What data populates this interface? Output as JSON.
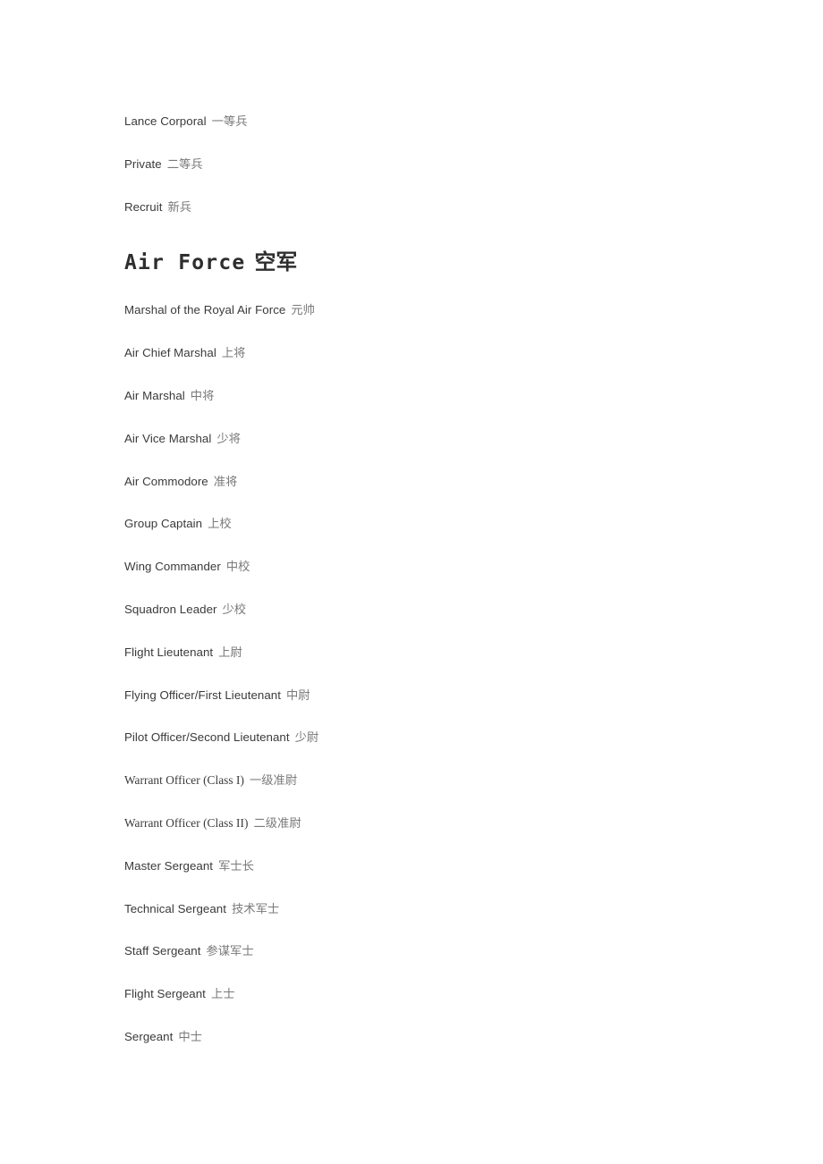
{
  "document": {
    "type": "bilingual-rank-list",
    "page_background": "#ffffff",
    "english_text_color": "#3a3a3a",
    "chinese_text_color": "#7a7a7a",
    "heading_color": "#2e2e2e"
  },
  "continued_entries": [
    {
      "en": "Lance Corporal",
      "zh": "一等兵"
    },
    {
      "en": "Private",
      "zh": "二等兵"
    },
    {
      "en": "Recruit",
      "zh": "新兵"
    }
  ],
  "section": {
    "heading_en": "Air Force",
    "heading_zh": "空军"
  },
  "air_force_ranks": [
    {
      "en": "Marshal of the Royal Air Force",
      "zh": "元帅"
    },
    {
      "en": "Air Chief Marshal",
      "zh": "上将"
    },
    {
      "en": "Air Marshal",
      "zh": "中将"
    },
    {
      "en": "Air Vice Marshal",
      "zh": "少将"
    },
    {
      "en": "Air Commodore",
      "zh": "准将"
    },
    {
      "en": "Group Captain",
      "zh": "上校"
    },
    {
      "en": "Wing Commander",
      "zh": "中校"
    },
    {
      "en": "Squadron Leader",
      "zh": "少校"
    },
    {
      "en": "Flight Lieutenant",
      "zh": "上尉"
    },
    {
      "en": "Flying Officer/First Lieutenant",
      "zh": "中尉"
    },
    {
      "en": "Pilot Officer/Second Lieutenant",
      "zh": "少尉"
    },
    {
      "en": "Warrant Officer (Class I)",
      "zh": "一级准尉"
    },
    {
      "en": "Warrant Officer (Class II)",
      "zh": "二级准尉"
    },
    {
      "en": "Master Sergeant",
      "zh": "军士长"
    },
    {
      "en": "Technical Sergeant",
      "zh": "技术军士"
    },
    {
      "en": "Staff Sergeant",
      "zh": "参谋军士"
    },
    {
      "en": "Flight Sergeant",
      "zh": "上士"
    },
    {
      "en": "Sergeant",
      "zh": "中士"
    }
  ]
}
